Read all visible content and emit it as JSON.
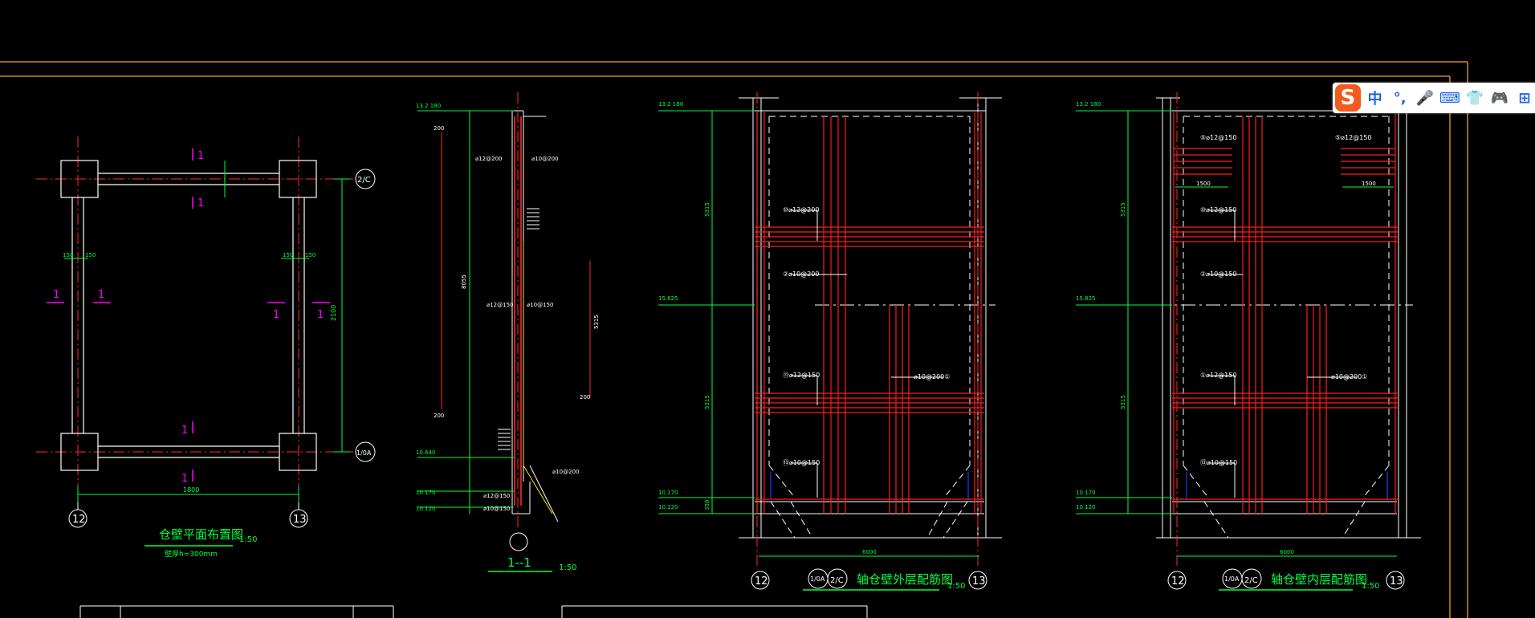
{
  "drawing": {
    "plan": {
      "title": "仓壁平面布置图",
      "scale": "1:50",
      "note": "壁厚h=300mm",
      "axis_left": "12",
      "axis_right": "13",
      "axis_top": "2/C",
      "axis_bottom": "1/0A",
      "section_mark": "1",
      "dim_width": "1800",
      "dim_height": "2100",
      "dim_small": "150"
    },
    "section": {
      "title": "1--1",
      "scale": "1:50",
      "elevations": [
        "13.2 180",
        "10.640",
        "10.170",
        "10.120"
      ],
      "rebar_notes": [
        "⌀12@200",
        "⌀10@200",
        "⌀12@150",
        "⌀10@150"
      ],
      "dims": [
        "200",
        "8055",
        "200",
        "5315",
        "200"
      ]
    },
    "outer": {
      "title": "轴仓壁外层配筋图",
      "scale": "1:50",
      "axis_left": "12",
      "axis_right": "13",
      "axis_tag1": "1/0A",
      "axis_tag2": "2/C",
      "dim_bottom": "6000",
      "elevations": [
        "13.2 180",
        "15.825",
        "10.170",
        "10.120"
      ],
      "rebar_notes": [
        "⑩⌀12@200",
        "②⌀10@200",
        "⑪⌀12@150",
        "⌀10@200①",
        "⑬⌀10@150"
      ],
      "dims": [
        "5315",
        "5315",
        "350"
      ]
    },
    "inner": {
      "title": "轴仓壁内层配筋图",
      "scale": "1:50",
      "axis_left": "12",
      "axis_right": "13",
      "axis_tag1": "1/0A",
      "axis_tag2": "2/C",
      "dim_bottom": "6000",
      "elevations": [
        "13.2 180",
        "15.825",
        "10.170",
        "10.120"
      ],
      "rebar_notes": [
        "⑤⌀12@150",
        "⑤⌀12@150",
        "⑩⌀12@150",
        "②⌀10@150",
        "①⌀12@150",
        "⌀10@200①",
        "⑬⌀10@150"
      ],
      "dims": [
        "1500",
        "1500",
        "5315",
        "5315"
      ]
    }
  },
  "ime_toolbar": {
    "logo": "S",
    "items": [
      {
        "label": "中",
        "icon": "chinese-mode-icon"
      },
      {
        "label": "°,",
        "icon": "punctuation-icon"
      },
      {
        "label": "🎤",
        "icon": "microphone-icon"
      },
      {
        "label": "⌨",
        "icon": "keyboard-icon"
      },
      {
        "label": "👕",
        "icon": "skin-icon"
      },
      {
        "label": "🎮",
        "icon": "game-icon"
      },
      {
        "label": "⊞",
        "icon": "toolbox-icon"
      }
    ]
  },
  "colors": {
    "background": "#000000",
    "frame": "#d08a20",
    "dim_green": "#00ff3c",
    "rebar_red": "#ff1c1c",
    "wall_white": "#ffffff",
    "section_magenta": "#ff00ff",
    "ime_blue": "#1f63e0",
    "ime_logo": "#f25a1e"
  }
}
